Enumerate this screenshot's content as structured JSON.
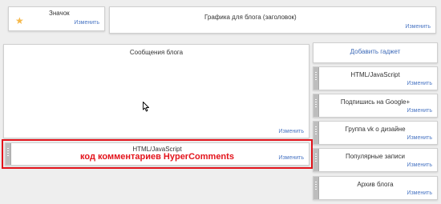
{
  "header": {
    "icon_gadget": {
      "title": "Значок",
      "edit": "Изменить"
    },
    "header_gadget": {
      "title": "Графика для блога (заголовок)",
      "edit": "Изменить"
    }
  },
  "main": {
    "posts": {
      "title": "Сообщения блога",
      "edit": "Изменить"
    },
    "html_gadget": {
      "title": "HTML/JavaScript",
      "note": "код комментариев HyperComments",
      "edit": "Изменить"
    }
  },
  "sidebar": {
    "add_gadget": "Добавить гаджет",
    "gadgets": [
      {
        "title": "HTML/JavaScript",
        "edit": "Изменить"
      },
      {
        "title": "Подпишись на Google+",
        "edit": "Изменить"
      },
      {
        "title": "Группа vk о дизайне",
        "edit": "Изменить"
      },
      {
        "title": "Популярные записи",
        "edit": "Изменить"
      },
      {
        "title": "Архив блога",
        "edit": "Изменить"
      }
    ]
  },
  "colors": {
    "link": "#4a76c4",
    "highlight": "#e3141c",
    "star": "#f6b84a"
  },
  "icons": [
    "star-icon",
    "mouse-cursor-icon"
  ]
}
